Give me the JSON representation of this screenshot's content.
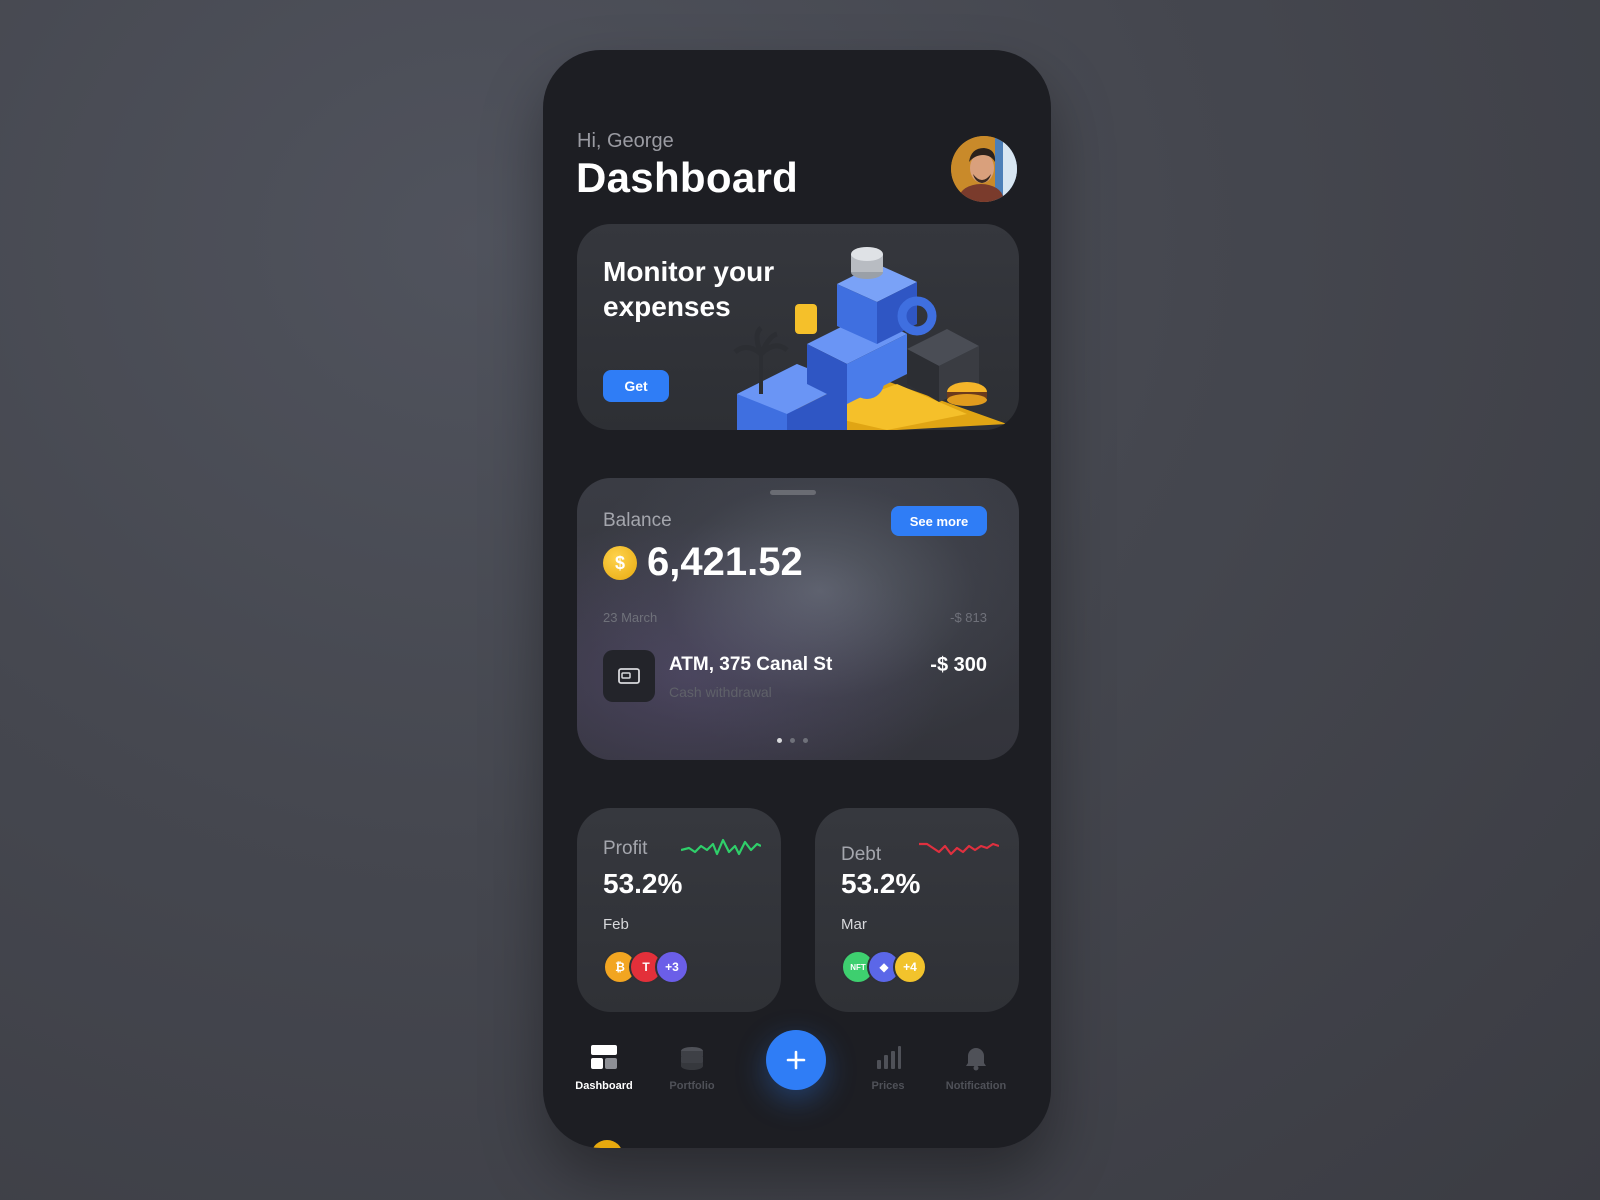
{
  "header": {
    "greeting": "Hi, George",
    "title": "Dashboard"
  },
  "promo": {
    "title": "Monitor your expenses",
    "button": "Get"
  },
  "balance": {
    "label": "Balance",
    "see_more": "See more",
    "currency_symbol": "$",
    "amount": "6,421.52",
    "date": "23 March",
    "date_total": "-$ 813",
    "transaction": {
      "title": "ATM, 375 Canal St",
      "subtitle": "Cash withdrawal",
      "amount": "-$ 300"
    },
    "page_count": 3,
    "active_page": 1
  },
  "stats": [
    {
      "label": "Profit",
      "value": "53.2%",
      "month": "Feb",
      "trend_color": "#2fcf6a",
      "coins": [
        {
          "icon": "bitcoin-icon",
          "glyph": "₿",
          "color": "#f2a521"
        },
        {
          "icon": "tesla-icon",
          "glyph": "T",
          "color": "#e3303a"
        },
        {
          "text": "+3",
          "color": "#6b5ee8"
        }
      ]
    },
    {
      "label": "Debt",
      "value": "53.2%",
      "month": "Mar",
      "trend_color": "#e0303f",
      "coins": [
        {
          "icon": "nft-icon",
          "glyph": "NFT",
          "color": "#3ecf6f"
        },
        {
          "icon": "ethereum-icon",
          "glyph": "◆",
          "color": "#5b67e8"
        },
        {
          "text": "+4",
          "color": "#f2c32c"
        }
      ]
    }
  ],
  "nav": {
    "items": [
      {
        "label": "Dashboard",
        "icon": "dashboard-icon",
        "active": true
      },
      {
        "label": "Portfolio",
        "icon": "portfolio-icon",
        "active": false
      },
      {
        "label": "Prices",
        "icon": "prices-icon",
        "active": false
      },
      {
        "label": "Notification",
        "icon": "notification-icon",
        "active": false
      }
    ],
    "fab_icon": "plus-icon"
  },
  "colors": {
    "accent": "#2f7df6",
    "coin_gold": "#e7a90e",
    "background": "#1d1e23"
  }
}
